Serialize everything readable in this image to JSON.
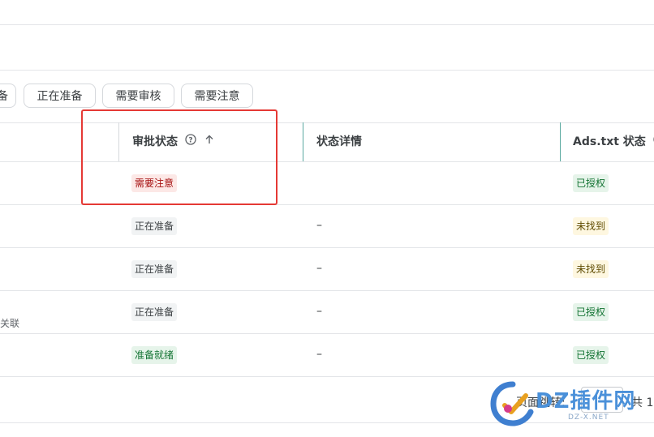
{
  "filter_chips": [
    {
      "label": "备"
    },
    {
      "label": "正在准备"
    },
    {
      "label": "需要审核"
    },
    {
      "label": "需要注意"
    }
  ],
  "table": {
    "headers": {
      "approval_status": "审批状态",
      "status_details": "状态详情",
      "ads_txt_status": "Ads.txt 状态"
    },
    "rows": [
      {
        "left_text": "",
        "approval": "需要注意",
        "approval_kind": "attention",
        "details": "",
        "ads": "已授权",
        "ads_kind": "authorized"
      },
      {
        "left_text": "",
        "approval": "正在准备",
        "approval_kind": "preparing",
        "details": "–",
        "ads": "未找到",
        "ads_kind": "notfound"
      },
      {
        "left_text": "",
        "approval": "正在准备",
        "approval_kind": "preparing",
        "details": "–",
        "ads": "未找到",
        "ads_kind": "notfound"
      },
      {
        "left_text": "关联",
        "approval": "正在准备",
        "approval_kind": "preparing",
        "details": "–",
        "ads": "已授权",
        "ads_kind": "authorized"
      },
      {
        "left_text": "",
        "approval": "准备就绪",
        "approval_kind": "ready",
        "details": "–",
        "ads": "已授权",
        "ads_kind": "authorized"
      }
    ]
  },
  "footer": {
    "page_jump_label": "页面跳转:",
    "total_label": "共 1"
  },
  "watermark": {
    "main": "DZ插件网",
    "sub": "DZ-X.NET"
  },
  "colors": {
    "highlight_border": "#e53935",
    "header_separator_teal": "#5aa9a0"
  }
}
